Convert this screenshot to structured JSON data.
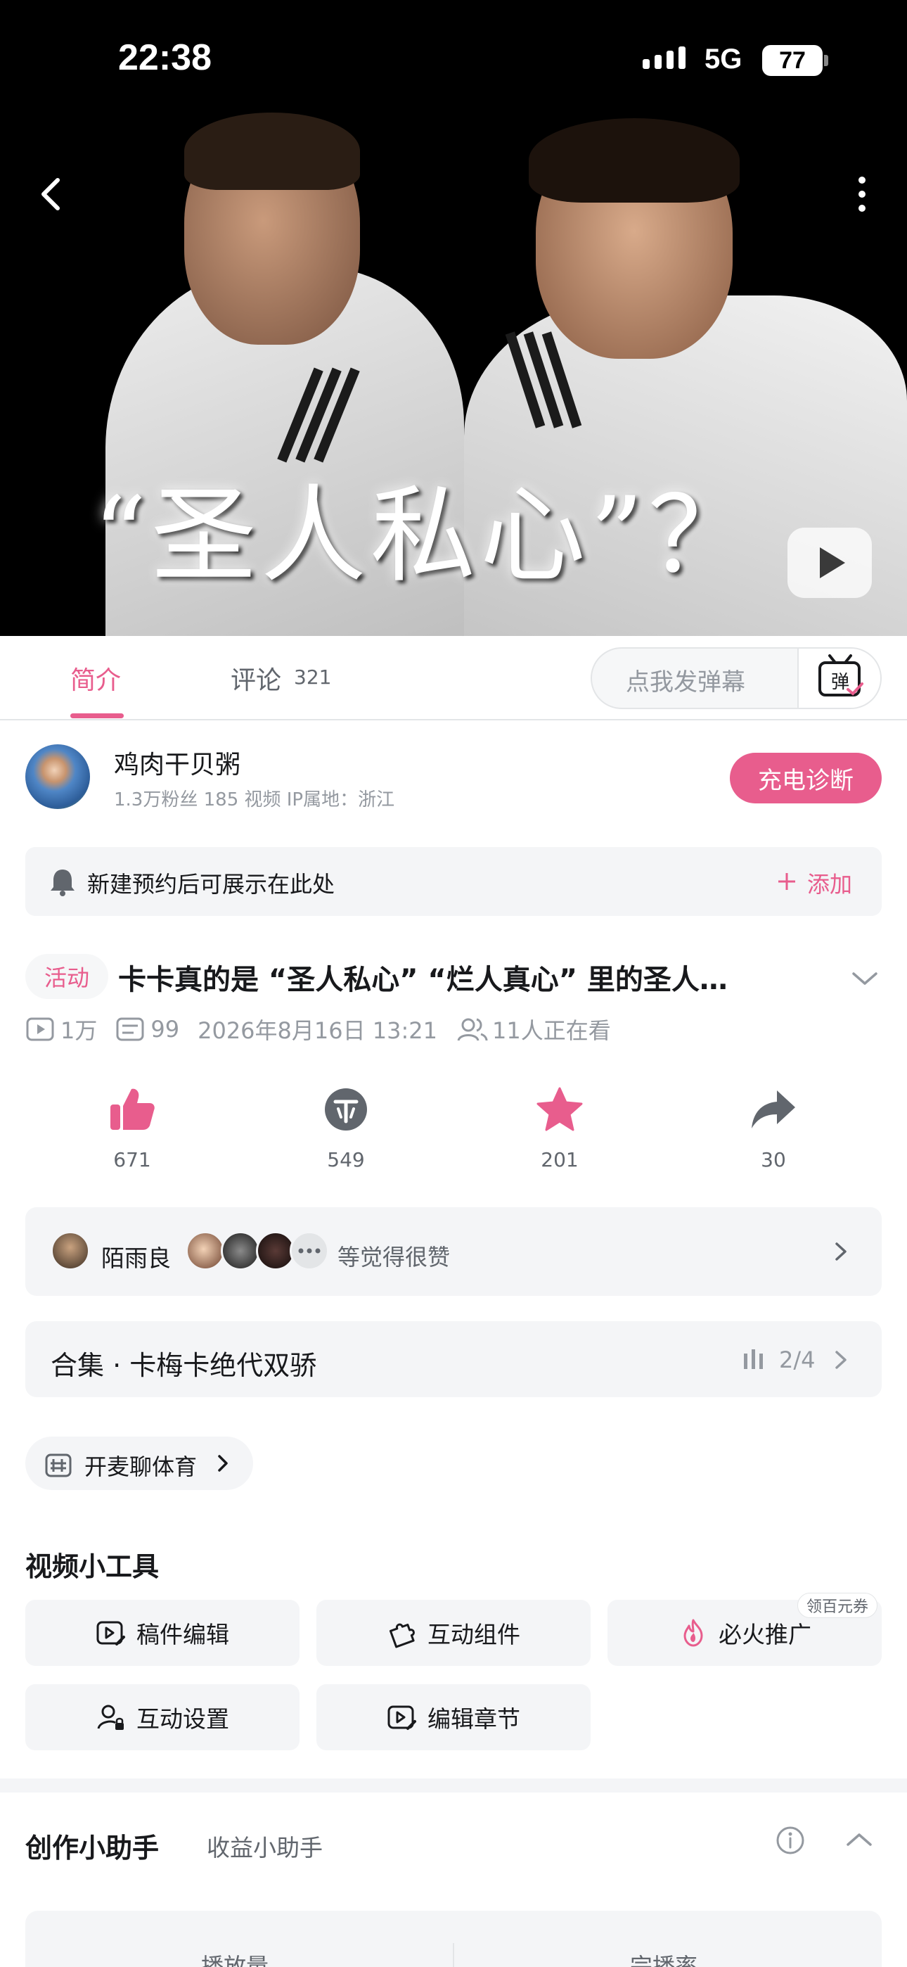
{
  "status_bar": {
    "time": "22:38",
    "network": "5G",
    "battery": "77"
  },
  "hero": {
    "title_text": "“圣人私心”？"
  },
  "tabs": {
    "intro_label": "简介",
    "comments_label": "评论",
    "comments_count": "321",
    "danmaku_placeholder": "点我发弹幕",
    "danmaku_icon_label": "弹"
  },
  "uploader": {
    "name": "鸡肉干贝粥",
    "meta": "1.3万粉丝   185 视频   IP属地：浙江",
    "charge_button": "充电诊断"
  },
  "reservation": {
    "text": "新建预约后可展示在此处",
    "add_label": "添加"
  },
  "video": {
    "tag": "活动",
    "title": "卡卡真的是 “圣人私心” “烂人真心” 里的圣人…",
    "views": "1万",
    "danmaku_count": "99",
    "publish_time": "2026年8月16日 13:21",
    "watching": "11人正在看"
  },
  "actions": [
    {
      "name": "like",
      "count": "671"
    },
    {
      "name": "coin",
      "count": "549"
    },
    {
      "name": "favorite",
      "count": "201"
    },
    {
      "name": "share",
      "count": "30"
    }
  ],
  "liked_by": {
    "first_user": "陌雨良",
    "suffix": "等觉得很赞"
  },
  "collection": {
    "title": "合集 · 卡梅卡绝代双骄",
    "progress": "2/4"
  },
  "topic_pill": {
    "label": "开麦聊体育"
  },
  "tools": {
    "section_title": "视频小工具",
    "items": [
      {
        "label": "稿件编辑",
        "icon": "edit-video-icon"
      },
      {
        "label": "互动组件",
        "icon": "puzzle-icon"
      },
      {
        "label": "必火推广",
        "icon": "flame-icon"
      },
      {
        "label": "互动设置",
        "icon": "user-lock-icon"
      },
      {
        "label": "编辑章节",
        "icon": "chapter-edit-icon"
      }
    ],
    "promo_badge": "领百元券"
  },
  "assistant": {
    "title": "创作小助手",
    "sub_tab": "收益小助手",
    "stats": [
      {
        "label": "播放量"
      },
      {
        "label": "完播率"
      }
    ]
  },
  "colors": {
    "accent": "#e85d8d",
    "card_bg": "#f4f5f7",
    "muted": "#9499a0"
  }
}
